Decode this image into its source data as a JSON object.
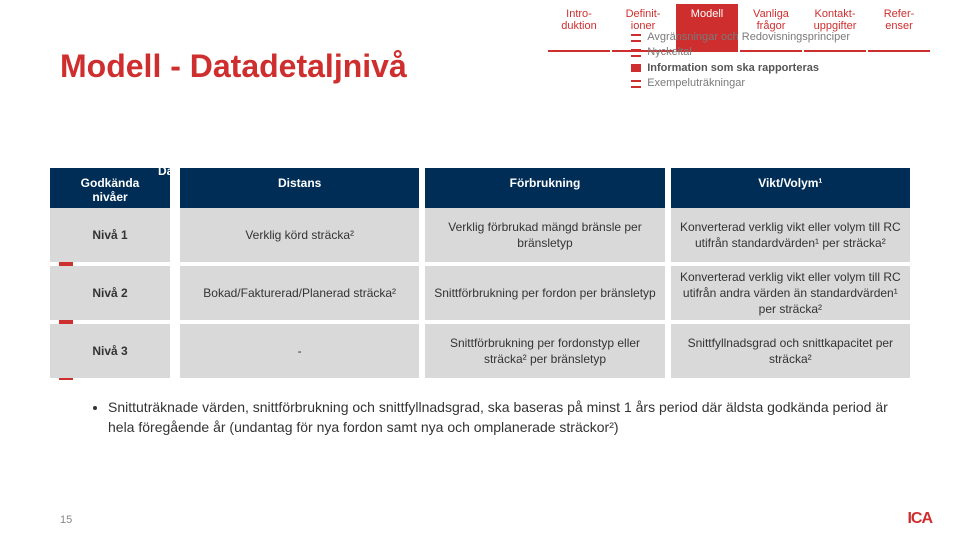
{
  "title": "Modell - Datadetaljnivå",
  "tabs": [
    {
      "l1": "Intro-",
      "l2": "duktion"
    },
    {
      "l1": "Definit-",
      "l2": "ioner"
    },
    {
      "l1": "Modell",
      "l2": ""
    },
    {
      "l1": "Vanliga",
      "l2": "frågor"
    },
    {
      "l1": "Kontakt-",
      "l2": "uppgifter"
    },
    {
      "l1": "Refer-",
      "l2": "enser"
    }
  ],
  "subnav": {
    "r1": "Avgränsningar och Redovisningsprinciper",
    "r2": "Nyckeltal",
    "r3": "Information som ska rapporteras",
    "r4": "Exempeluträkningar"
  },
  "table": {
    "datatyp_label": "Datatyp",
    "corner_l1": "Godkända",
    "corner_l2": "nivåer",
    "cols": [
      "Distans",
      "Förbrukning",
      "Vikt/Volym¹"
    ],
    "rows": [
      {
        "level": "Nivå 1",
        "c1": "Verklig körd sträcka²",
        "c2": "Verklig förbrukad mängd bränsle per bränsletyp",
        "c3": "Konverterad verklig vikt eller volym till RC utifrån standardvärden¹ per sträcka²"
      },
      {
        "level": "Nivå 2",
        "c1": "Bokad/Fakturerad/Planerad sträcka²",
        "c2": "Snittförbrukning per fordon per bränsletyp",
        "c3": "Konverterad verklig vikt eller volym till RC utifrån andra värden än standardvärden¹ per sträcka²"
      },
      {
        "level": "Nivå 3",
        "c1": "-",
        "c2": "Snittförbrukning per fordonstyp eller sträcka² per bränsletyp",
        "c3": "Snittfyllnadsgrad och snittkapacitet per sträcka²"
      }
    ]
  },
  "note": "Snittuträknade värden, snittförbrukning och snittfyllnadsgrad, ska baseras på minst 1 års period där äldsta godkända period är hela föregående år (undantag för nya fordon samt nya och omplanerade sträckor²)",
  "pagenum": "15",
  "logo": "ICA"
}
